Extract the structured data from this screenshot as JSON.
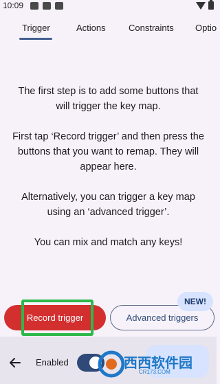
{
  "status_bar": {
    "time": "10:09"
  },
  "tabs": [
    {
      "label": "Trigger",
      "active": true
    },
    {
      "label": "Actions",
      "active": false
    },
    {
      "label": "Constraints",
      "active": false
    },
    {
      "label": "Options",
      "active": false
    }
  ],
  "main": {
    "paragraphs": [
      "The first step is to add some buttons that will trigger the key map.",
      "First tap ‘Record trigger’ and then press the buttons that you want to remap. They will appear here.",
      "Alternatively, you can trigger a key map using an ‘advanced trigger’.",
      "You can mix and match any keys!"
    ]
  },
  "buttons": {
    "record_trigger": "Record trigger",
    "advanced_triggers": "Advanced triggers",
    "new_badge": "NEW!"
  },
  "bottom_bar": {
    "enabled_label": "Enabled",
    "enabled": true
  },
  "watermark": {
    "main": "西西软件园",
    "sub": "CR173.COM"
  },
  "colors": {
    "accent": "#415f91",
    "record_button": "#d32f2f",
    "highlight_box": "#2db84a",
    "badge_bg": "#d7e3ff"
  }
}
